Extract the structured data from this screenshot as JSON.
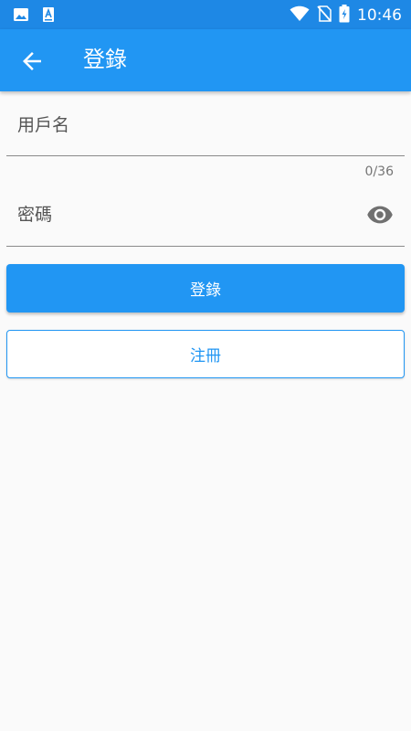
{
  "status_bar": {
    "time": "10:46",
    "left_icons": [
      "image-icon",
      "app-a-icon"
    ],
    "right_icons": [
      "wifi-icon",
      "no-sim-icon",
      "battery-charging-icon"
    ],
    "color": "#1e88e5"
  },
  "app_bar": {
    "title": "登錄",
    "back_icon": "arrow-back-icon",
    "color": "#2196f3"
  },
  "form": {
    "username": {
      "placeholder": "用戶名",
      "value": "",
      "counter": "0/36"
    },
    "password": {
      "placeholder": "密碼",
      "value": "",
      "toggle_icon": "eye-icon"
    }
  },
  "buttons": {
    "login_label": "登錄",
    "register_label": "注冊"
  },
  "colors": {
    "primary": "#2196f3",
    "background": "#fafafa"
  }
}
